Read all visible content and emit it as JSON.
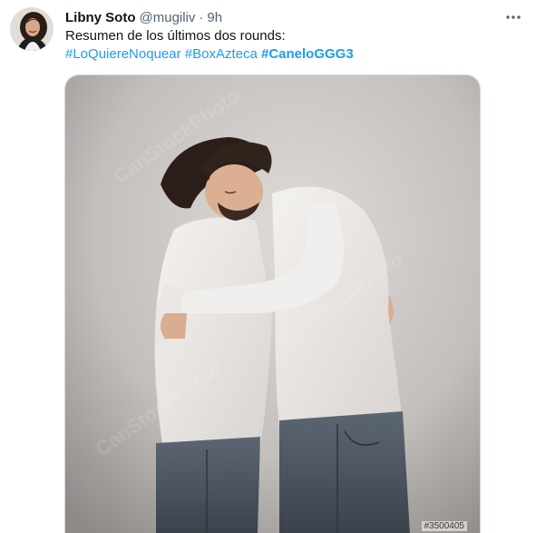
{
  "author": {
    "name": "Libny Soto",
    "handle": "@mugiliv",
    "separator": "·",
    "time": "9h"
  },
  "tweet": {
    "text": "Resumen de los últimos dos rounds:",
    "hashtags": [
      "#LoQuiereNoquear",
      "#BoxAzteca",
      "#CaneloGGG3"
    ]
  },
  "media": {
    "stock_id": "#3500405"
  },
  "icons": {
    "more": "more-options-icon"
  },
  "colors": {
    "link": "#1d9bf0",
    "secondary_text": "#536471",
    "primary_text": "#0f1419"
  }
}
